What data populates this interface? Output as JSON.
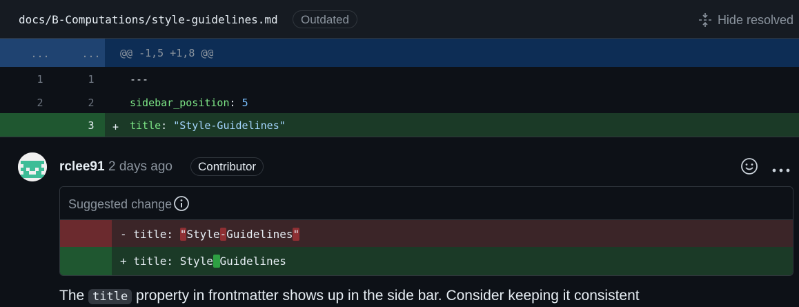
{
  "file": {
    "path": "docs/B-Computations/style-guidelines.md",
    "status_badge": "Outdated",
    "hide_resolved_label": "Hide resolved"
  },
  "diff": {
    "hunk": {
      "left": "...",
      "right": "...",
      "header": "@@ -1,5 +1,8 @@"
    },
    "lines": [
      {
        "old": "1",
        "new": "1",
        "code": "---"
      },
      {
        "old": "2",
        "new": "2",
        "key": "sidebar_position",
        "sep": ": ",
        "value": "5"
      },
      {
        "old": "",
        "new": "3",
        "marker": "+",
        "key": "title",
        "sep": ": ",
        "value": "\"Style-Guidelines\""
      }
    ]
  },
  "comment": {
    "author": "rclee91",
    "time": "2 days ago",
    "role": "Contributor",
    "suggestion": {
      "title": "Suggested change",
      "removed": {
        "prefix": "- title: ",
        "q1": "\"",
        "a": "Style",
        "dash": "-",
        "b": "Guidelines",
        "q2": "\""
      },
      "added": {
        "prefix": "+ title: ",
        "a": "Style",
        "space": " ",
        "b": "Guidelines"
      }
    },
    "body": {
      "before": "The ",
      "code": "title",
      "after": " property in frontmatter shows up in the side bar. Consider keeping it consistent"
    }
  },
  "colors": {
    "background": "#0d1117",
    "add_bg": "#1b3a27",
    "del_bg": "#3b2528",
    "hunk_bg": "#0d2d55"
  },
  "icons": [
    "unfold-icon",
    "info-icon",
    "smiley-icon",
    "kebab-icon",
    "avatar"
  ]
}
